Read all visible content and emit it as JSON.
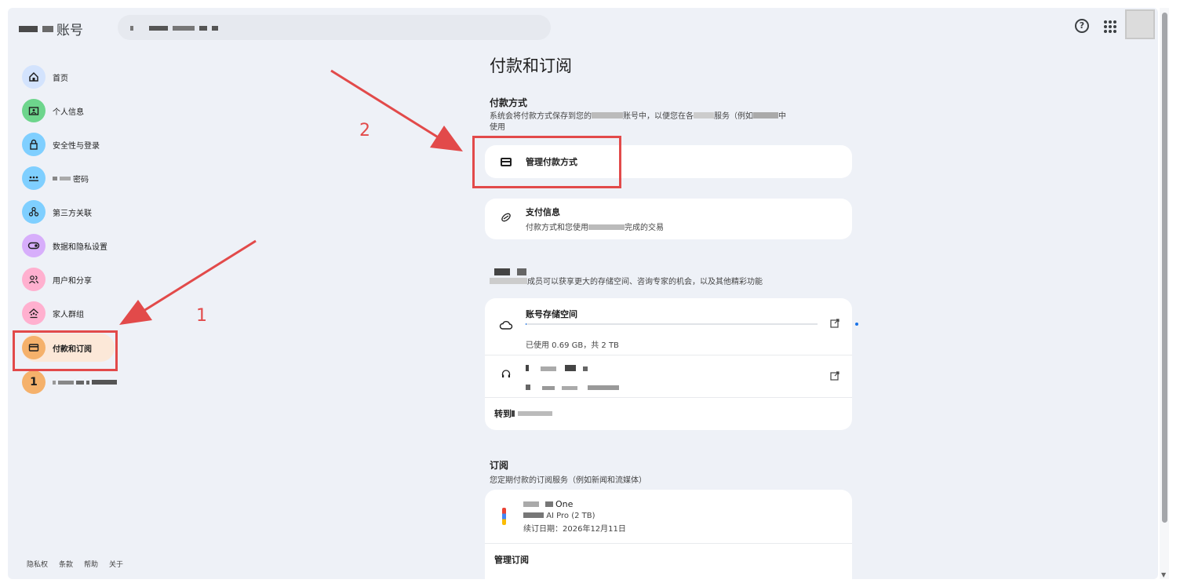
{
  "header": {
    "app_name": "账号",
    "search_placeholder": ""
  },
  "sidebar": {
    "items": [
      {
        "label": "首页",
        "icon": "home-icon",
        "color": "#d3e3fd"
      },
      {
        "label": "个人信息",
        "icon": "id-card-icon",
        "color": "#6dd58c"
      },
      {
        "label": "安全性与登录",
        "icon": "lock-icon",
        "color": "#7fcfff"
      },
      {
        "label": "密码",
        "icon": "password-dots-icon",
        "color": "#7fcfff"
      },
      {
        "label": "第三方关联",
        "icon": "connections-icon",
        "color": "#7fcfff"
      },
      {
        "label": "数据和隐私设置",
        "icon": "toggle-icon",
        "color": "#d7aefb"
      },
      {
        "label": "用户和分享",
        "icon": "people-icon",
        "color": "#ffb0cf"
      },
      {
        "label": "家人群组",
        "icon": "family-icon",
        "color": "#ffb0cf"
      },
      {
        "label": "付款和订阅",
        "icon": "payment-card-icon",
        "color": "#f5b16b"
      },
      {
        "label": "",
        "icon": "one-icon",
        "color": "#f5b16b"
      }
    ],
    "footer_links": [
      "隐私权",
      "条款",
      "帮助",
      "关于"
    ]
  },
  "main": {
    "title": "付款和订阅",
    "payment_methods": {
      "heading": "付款方式",
      "desc_part1": "系统会将付款方式保存到您的",
      "desc_part2": "账号中，以便您在各",
      "desc_part3": "服务（例如",
      "desc_part4": "中",
      "desc_line2": "使用",
      "manage_label": "管理付款方式",
      "payment_info_title": "支付信息",
      "payment_info_sub_part1": "付款方式和您使用",
      "payment_info_sub_part2": "完成的交易"
    },
    "membership": {
      "desc": "成员可以获享更大的存储空间、咨询专家的机会，以及其他精彩功能",
      "storage_title": "账号存储空间",
      "storage_sub": "已使用 0.69 GB，共 2 TB",
      "storage_used_fraction": 0.00034,
      "goto_label": "转到"
    },
    "subscriptions": {
      "heading": "订阅",
      "desc": "您定期付款的订阅服务（例如新闻和流媒体）",
      "item_name": "One",
      "item_plan": "AI Pro (2 TB)",
      "item_renewal": "续订日期：2026年12月11日",
      "manage_label": "管理订阅"
    }
  },
  "annotations": {
    "step1": "1",
    "step2": "2",
    "color": "#e24a4a"
  }
}
